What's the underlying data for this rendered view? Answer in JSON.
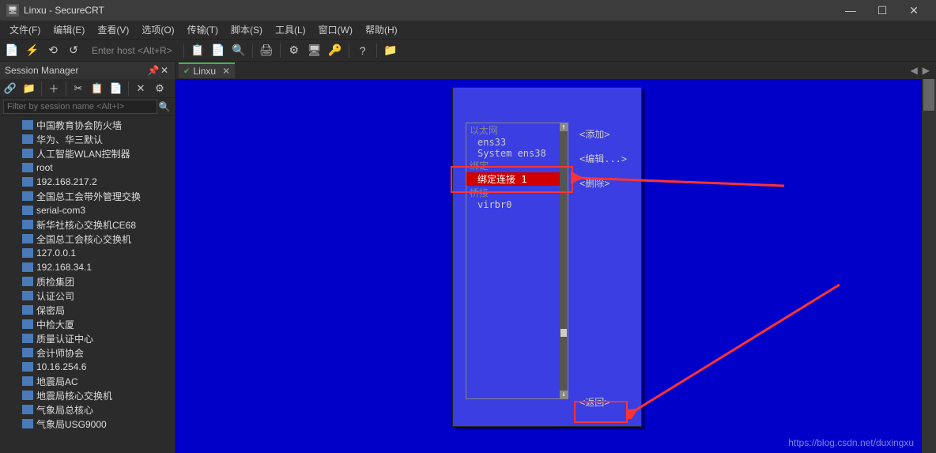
{
  "window": {
    "title": "Linxu - SecureCRT"
  },
  "menu": {
    "file": "文件(F)",
    "edit": "编辑(E)",
    "view": "查看(V)",
    "options": "选项(O)",
    "transfer": "传输(T)",
    "script": "脚本(S)",
    "tools": "工具(L)",
    "window": "窗口(W)",
    "help": "帮助(H)"
  },
  "toolbar": {
    "host_placeholder": "Enter host <Alt+R>"
  },
  "session_manager": {
    "title": "Session Manager",
    "filter_placeholder": "Filter by session name <Alt+I>",
    "items": [
      "中国教育协会防火墙",
      "华为、华三默认",
      "人工智能WLAN控制器",
      "root",
      "192.168.217.2",
      "全国总工会带外管理交换",
      "serial-com3",
      "新华社核心交换机CE68",
      "全国总工会核心交换机",
      "127.0.0.1",
      "192.168.34.1",
      "质检集团",
      "认证公司",
      "保密局",
      "中检大厦",
      "质量认证中心",
      "会计师协会",
      "10.16.254.6",
      "地震局AC",
      "地震局核心交换机",
      "气象局总核心",
      "气象局USG9000"
    ]
  },
  "tab": {
    "label": "Linxu"
  },
  "dialog": {
    "sections": {
      "ethernet": "以太网",
      "ethernet_items": [
        "ens33",
        "System ens38"
      ],
      "bond": "绑定",
      "bond_selected": "绑定连接 1",
      "bridge": "桥接",
      "bridge_items": [
        "virbr0"
      ]
    },
    "buttons": {
      "add": "<添加>",
      "edit": "<编辑...>",
      "delete": "<删除>",
      "back": "<返回>"
    }
  },
  "watermark": "https://blog.csdn.net/duxingxu"
}
